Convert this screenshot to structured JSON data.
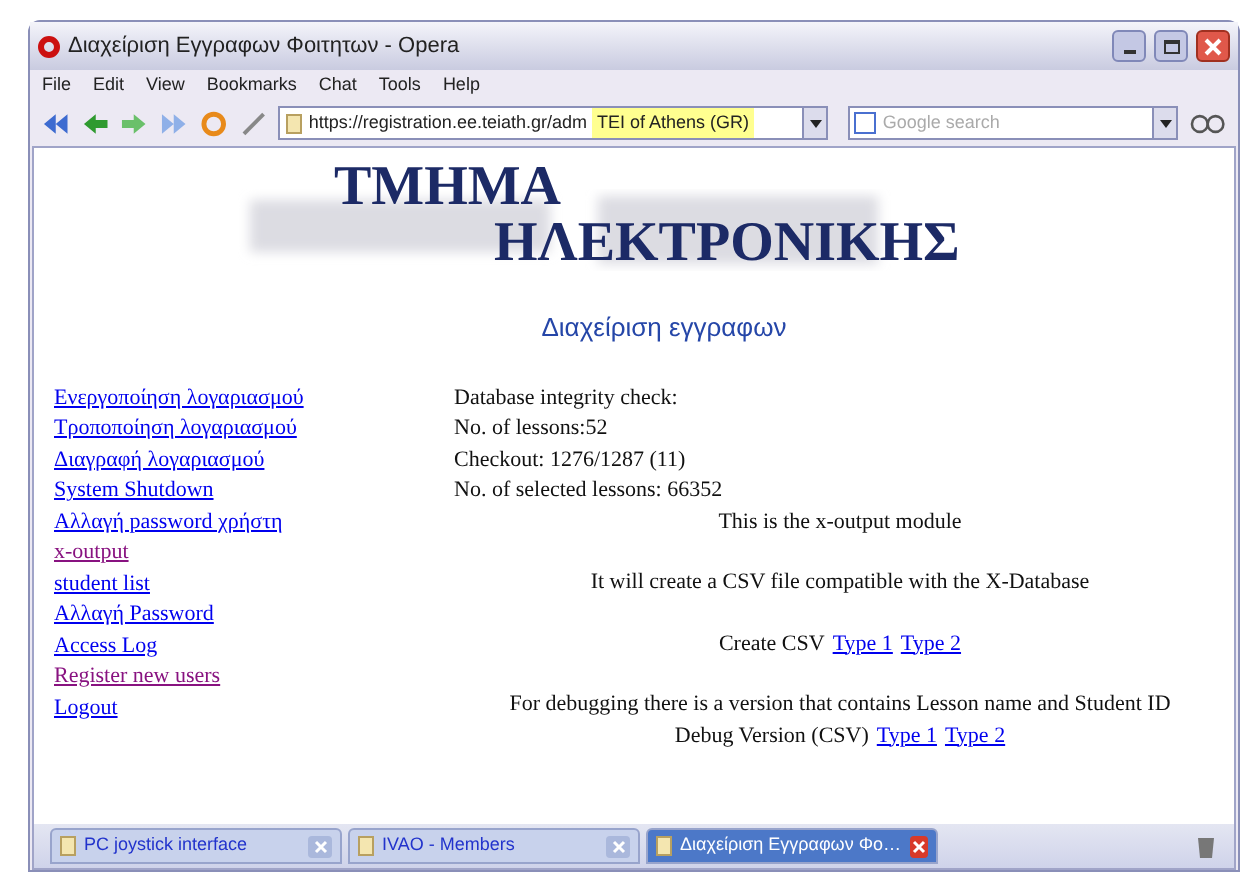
{
  "window": {
    "title": "Διαχείριση Εγγραφων Φοιτητων - Opera"
  },
  "menu": [
    "File",
    "Edit",
    "View",
    "Bookmarks",
    "Chat",
    "Tools",
    "Help"
  ],
  "address": {
    "value": "https://registration.ee.teiath.gr/adm",
    "security": "TEI of Athens (GR)"
  },
  "search": {
    "placeholder": "Google search"
  },
  "logo": {
    "line_1": "ΤΜΗΜΑ",
    "line_2": "ΗΛΕΚΤΡΟΝΙΚΗΣ"
  },
  "page_title": "Διαχείριση εγγραφων",
  "nav": [
    {
      "label": "Ενεργοποίηση λογαριασμού",
      "visited": false
    },
    {
      "label": "Τροποποίηση λογαριασμού",
      "visited": false
    },
    {
      "label": "Διαγραφή λογαριασμού",
      "visited": false
    },
    {
      "label": "System Shutdown",
      "visited": false
    },
    {
      "label": "Αλλαγή password χρήστη",
      "visited": false
    },
    {
      "label": "x-output",
      "visited": true
    },
    {
      "label": "student list",
      "visited": false
    },
    {
      "label": "Αλλαγή Password",
      "visited": false
    },
    {
      "label": "Access Log",
      "visited": false
    },
    {
      "label": "Register new users",
      "visited": true
    },
    {
      "label": "Logout",
      "visited": false
    }
  ],
  "status_lines": [
    "Database integrity check:",
    "No. of lessons:52",
    "Checkout: 1276/1287 (11)",
    "No. of selected lessons: 66352"
  ],
  "module_title": "This is the x-output module",
  "description": "It will create a CSV file compatible with the X-Database",
  "create_csv": {
    "label": "Create CSV",
    "links": [
      "Type 1",
      "Type 2"
    ]
  },
  "debug_note": "For debugging there is a version that contains Lesson name and Student ID",
  "debug_csv": {
    "label": "Debug Version (CSV)",
    "links": [
      "Type 1",
      "Type 2"
    ]
  },
  "tabs": [
    {
      "label": "PC joystick interface",
      "selected": false
    },
    {
      "label": "IVAO - Members",
      "selected": false
    },
    {
      "label": "Διαχείριση Εγγραφων Φο…",
      "selected": true
    }
  ]
}
